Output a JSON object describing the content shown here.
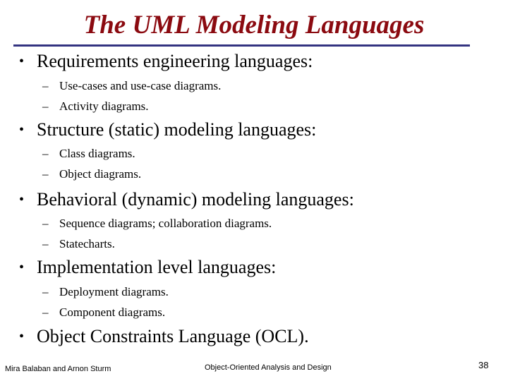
{
  "slide": {
    "title": "The UML Modeling Languages",
    "bullets": [
      {
        "text": "Requirements engineering languages:",
        "subs": [
          "Use-cases and use-case diagrams.",
          "Activity diagrams."
        ]
      },
      {
        "text": "Structure (static) modeling languages:",
        "subs": [
          "Class diagrams.",
          "Object diagrams."
        ]
      },
      {
        "text": "Behavioral (dynamic) modeling languages:",
        "subs": [
          "Sequence diagrams; collaboration diagrams.",
          "Statecharts."
        ]
      },
      {
        "text": "Implementation level languages:",
        "subs": [
          "Deployment diagrams.",
          "Component diagrams."
        ]
      },
      {
        "text": "Object Constraints Language (OCL).",
        "subs": []
      }
    ],
    "bullet_glyph": "•",
    "sub_glyph": "–",
    "colors": {
      "title": "#8b0a10",
      "rule": "#333380"
    }
  },
  "footer": {
    "authors": "Mira Balaban and Arnon Sturm",
    "course": "Object-Oriented Analysis and Design",
    "page_number": "38"
  }
}
